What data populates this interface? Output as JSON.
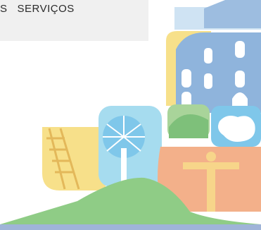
{
  "nav": {
    "label": "S   SERVIÇOS"
  },
  "illustration": {
    "icon": "city-collage-logo-icon",
    "colors": {
      "sky_blue": "#cfe3f3",
      "building_blue": "#8fb4dc",
      "yellow": "#f7e08a",
      "green": "#a9d49a",
      "dark_green": "#7ec07a",
      "orange": "#f3b08a",
      "cyan": "#a6dcef",
      "map_blue": "#7fc7ea",
      "accent_bar": "#9fb4d8"
    }
  }
}
